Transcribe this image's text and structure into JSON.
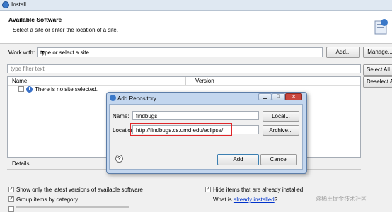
{
  "window": {
    "title": "Install"
  },
  "header": {
    "heading": "Available Software",
    "subheading": "Select a site or enter the location of a site."
  },
  "work_with": {
    "label": "Work with:",
    "placeholder": "type or select a site",
    "add_label": "Add...",
    "manage_label": "Manage..."
  },
  "filter": {
    "placeholder": "type filter text"
  },
  "side_buttons": {
    "select_all": "Select All",
    "deselect_all": "Deselect All"
  },
  "table": {
    "columns": [
      "Name",
      "Version"
    ],
    "rows": [
      {
        "name": "There is no site selected."
      }
    ]
  },
  "details": {
    "label": "Details"
  },
  "options": {
    "show_latest": "Show only the latest versions of available software",
    "group_by_category": "Group items by category",
    "hide_installed": "Hide items that are already installed",
    "what_is_prefix": "What is ",
    "already_installed_link": "already installed",
    "what_is_suffix": "?"
  },
  "dialog": {
    "title": "Add Repository",
    "name_label": "Name:",
    "name_value": "findbugs",
    "local_label": "Local...",
    "location_label": "Location:",
    "location_value": "http://findbugs.cs.umd.edu/eclipse/",
    "archive_label": "Archive...",
    "add_label": "Add",
    "cancel_label": "Cancel",
    "close_glyph": "✕"
  },
  "watermark": "@稀土掘金技术社区",
  "colors": {
    "highlight_box": "#e0262a",
    "link": "#0033cc",
    "dialog_frame": "#c3d6ee"
  }
}
